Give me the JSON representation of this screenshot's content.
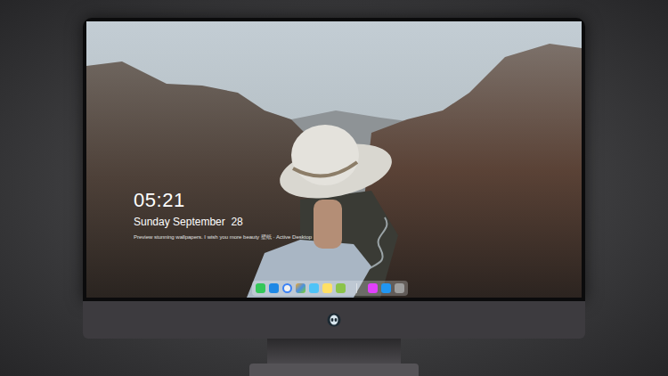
{
  "lock_screen": {
    "time": "05:21",
    "date": "Sunday September  28",
    "caption": "Preview stunning wallpapers. I wish you more beauty 壁纸 · Active Desktop"
  }
}
